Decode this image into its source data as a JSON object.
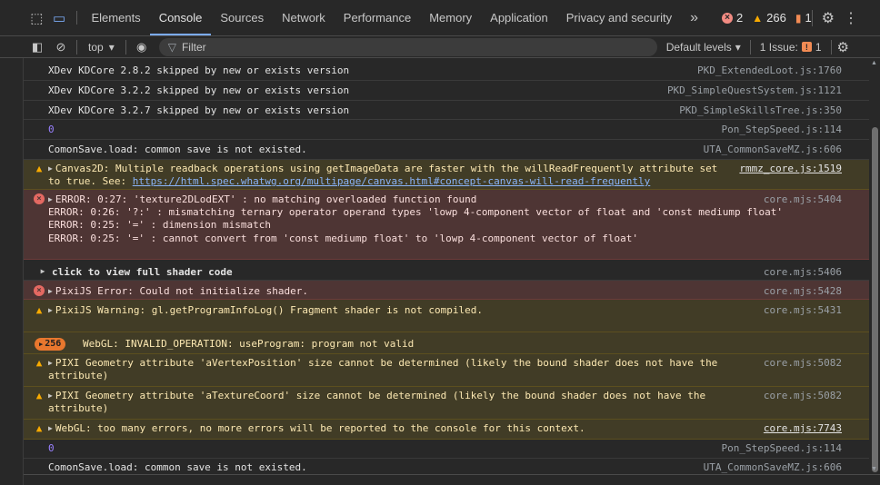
{
  "tabs": [
    {
      "label": "Elements"
    },
    {
      "label": "Console"
    },
    {
      "label": "Sources"
    },
    {
      "label": "Network"
    },
    {
      "label": "Performance"
    },
    {
      "label": "Memory"
    },
    {
      "label": "Application"
    },
    {
      "label": "Privacy and security"
    }
  ],
  "counts": {
    "errors": "2",
    "warnings": "266",
    "issues": "1"
  },
  "toolbar": {
    "context": "top",
    "filter_placeholder": "Filter",
    "levels": "Default levels",
    "issue_label": "1 Issue:",
    "issue_count": "1"
  },
  "messages": [
    {
      "type": "info",
      "text": "XDev KDCore 2.8.2 skipped by new or exists version",
      "source": "PKD_ExtendedLoot.js:1760"
    },
    {
      "type": "info",
      "text": "XDev KDCore 3.2.2 skipped by new or exists version",
      "source": "PKD_SimpleQuestSystem.js:1121"
    },
    {
      "type": "info",
      "text": "XDev KDCore 3.2.7 skipped by new or exists version",
      "source": "PKD_SimpleSkillsTree.js:350"
    },
    {
      "type": "num",
      "text": "0",
      "source": "Pon_StepSpeed.js:114"
    },
    {
      "type": "info",
      "text": "ComonSave.load: common save is not existed.",
      "source": "UTA_CommonSaveMZ.js:606"
    },
    {
      "type": "warn",
      "line1": "Canvas2D: Multiple readback operations using getImageData are faster with the willReadFrequently attribute set",
      "line2_prefix": "to true. See: ",
      "link": "https://html.spec.whatwg.org/multipage/canvas.html#concept-canvas-will-read-frequently",
      "source": "rmmz_core.js:1519"
    },
    {
      "type": "err",
      "lines": [
        "ERROR: 0:27: 'texture2DLodEXT' : no matching overloaded function found",
        "ERROR: 0:26: '?:' : mismatching ternary operator operand types 'lowp 4-component vector of float and 'const mediump float'",
        "ERROR: 0:25: '=' : dimension mismatch",
        "ERROR: 0:25: '=' : cannot convert from 'const mediump float' to 'lowp 4-component vector of float'"
      ],
      "source": "core.mjs:5404"
    },
    {
      "type": "group",
      "text": "click to view full shader code",
      "source": "core.mjs:5406"
    },
    {
      "type": "err",
      "text": "PixiJS Error: Could not initialize shader.",
      "source": "core.mjs:5428"
    },
    {
      "type": "warn",
      "text": "PixiJS Warning: gl.getProgramInfoLog() Fragment shader is not compiled.",
      "source": "core.mjs:5431"
    },
    {
      "type": "warn",
      "badge": "256",
      "text": "WebGL: INVALID_OPERATION: useProgram: program not valid"
    },
    {
      "type": "warn",
      "line1": "PIXI Geometry attribute 'aVertexPosition' size cannot be determined (likely the bound shader does not have the",
      "line2": "attribute)",
      "source": "core.mjs:5082"
    },
    {
      "type": "warn",
      "line1": "PIXI Geometry attribute 'aTextureCoord' size cannot be determined (likely the bound shader does not have the",
      "line2": "attribute)",
      "source": "core.mjs:5082"
    },
    {
      "type": "warn",
      "text": "WebGL: too many errors, no more errors will be reported to the console for this context.",
      "source": "core.mjs:7743"
    },
    {
      "type": "num",
      "text": "0",
      "source": "Pon_StepSpeed.js:114"
    },
    {
      "type": "info",
      "text": "ComonSave.load: common save is not existed.",
      "source": "UTA_CommonSaveMZ.js:606"
    }
  ]
}
